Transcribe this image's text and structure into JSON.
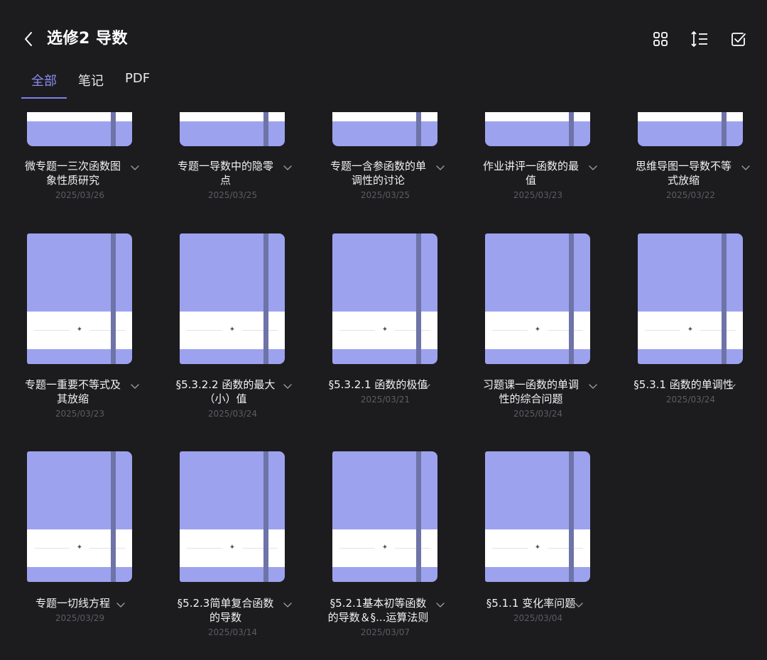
{
  "header": {
    "title": "选修2 导数"
  },
  "icons": {
    "back": "chevron-left-icon",
    "grid": "grid-view-icon",
    "sort": "sort-icon",
    "select": "checkbox-select-icon"
  },
  "tabs": [
    {
      "label": "全部",
      "active": true
    },
    {
      "label": "笔记"
    },
    {
      "label": "PDF"
    }
  ],
  "accent": "#7d80ee",
  "cover_color": "#9da2ee",
  "notebooks": [
    {
      "name_line1": "微专题一三次函数图",
      "name_line2": "象性质研究",
      "date": "2025/03/26"
    },
    {
      "name_line1": "专题一导数中的隐零",
      "name_line2": "点",
      "date": "2025/03/25"
    },
    {
      "name_line1": "专题一含参函数的单",
      "name_line2": "调性的讨论",
      "date": "2025/03/25"
    },
    {
      "name_line1": "作业讲评一函数的最",
      "name_line2": "值",
      "date": "2025/03/23"
    },
    {
      "name_line1": "思维导图一导数不等",
      "name_line2": "式放缩",
      "date": "2025/03/22"
    },
    {
      "name_line1": "专题一重要不等式及",
      "name_line2": "其放缩",
      "date": "2025/03/23"
    },
    {
      "name_line1": "§5.3.2.2 函数的最大",
      "name_line2": "（小）值",
      "date": "2025/03/24"
    },
    {
      "name_line1": "§5.3.2.1 函数的极值",
      "name_line2": "",
      "date": "2025/03/21"
    },
    {
      "name_line1": "习题课一函数的单调",
      "name_line2": "性的综合问题",
      "date": "2025/03/24"
    },
    {
      "name_line1": "§5.3.1 函数的单调性",
      "name_line2": "",
      "date": "2025/03/24"
    },
    {
      "name_line1": "专题一切线方程",
      "name_line2": "",
      "date": "2025/03/29"
    },
    {
      "name_line1": "§5.2.3简单复合函数",
      "name_line2": "的导数",
      "date": "2025/03/14"
    },
    {
      "name_line1": "§5.2.1基本初等函数",
      "name_line2": "的导数＆§...运算法则",
      "date": "2025/03/07"
    },
    {
      "name_line1": "§5.1.1 变化率问题",
      "name_line2": "",
      "date": "2025/03/04"
    }
  ]
}
